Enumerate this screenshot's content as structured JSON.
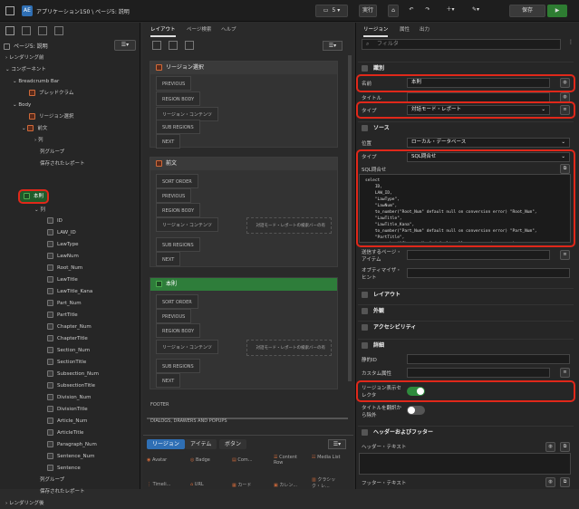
{
  "app": {
    "title": "アプリケーション150 \\ ページ5: 説明",
    "logo": "AE"
  },
  "toolbar": {
    "page_num": "5",
    "run": "実行",
    "save": "保存"
  },
  "left": {
    "title": "ページ5: 説明",
    "items": [
      "レンダリング前",
      "コンポーネント",
      "Breadcrumb Bar",
      "ブレッドクラム",
      "Body",
      "リージョン選択",
      "前文",
      "列",
      "列グループ",
      "保存されたレポート",
      "本則",
      "列",
      "ID",
      "LAW_ID",
      "LawType",
      "LawNum",
      "Root_Num",
      "LawTitle",
      "LawTitle_Kana",
      "Part_Num",
      "PartTitle",
      "Chapter_Num",
      "ChapterTitle",
      "Section_Num",
      "SectionTitle",
      "Subsection_Num",
      "SubsectionTitle",
      "Division_Num",
      "DivisionTitle",
      "Article_Num",
      "ArticleTitle",
      "Paragraph_Num",
      "Sentence_Num",
      "Sentence",
      "列グループ",
      "保存されたレポート",
      "レンダリング後"
    ]
  },
  "mid": {
    "tabs": [
      "レイアウト",
      "ページ検索",
      "ヘルプ"
    ],
    "r1": "リージョン選択",
    "r2": "前文",
    "r3": "本則",
    "slots1": [
      "PREVIOUS",
      "REGION BODY",
      "リージョン・コンテンツ",
      "SUB REGIONS",
      "NEXT"
    ],
    "slots2": [
      "SORT ORDER",
      "PREVIOUS",
      "REGION BODY",
      "リージョン・コンテンツ",
      "SUB REGIONS",
      "NEXT"
    ],
    "slots3": [
      "SORT ORDER",
      "PREVIOUS",
      "REGION BODY",
      "リージョン・コンテンツ",
      "SUB REGIONS",
      "NEXT"
    ],
    "card": "対話モード・レポートの検索バーの有",
    "footer": "FOOTER",
    "dialogs": "DIALOGS, DRAWERS AND POPUPS",
    "btabs": [
      "リージョン",
      "アイテム",
      "ボタン"
    ],
    "gallery": [
      "Avatar",
      "Badge",
      "Com...",
      "Content Row",
      "Media List",
      "Timeli...",
      "URL",
      "カード",
      "カレン...",
      "クラシック・レ..."
    ]
  },
  "right": {
    "tabs": [
      "リージョン",
      "属性",
      "出力"
    ],
    "filter": "フィルタ",
    "sec_id": "識別",
    "name_lbl": "名前",
    "name_val": "本則",
    "title_lbl": "タイトル",
    "type_lbl": "タイプ",
    "type_val": "対話モード・レポート",
    "sec_src": "ソース",
    "loc_lbl": "位置",
    "loc_val": "ローカル・データベース",
    "stype_lbl": "タイプ",
    "stype_val": "SQL問合せ",
    "sql_lbl": "SQL問合せ",
    "sql": "select\n    ID,\n    LAW_ID,\n    \"LawType\",\n    \"LawNum\",\n    to_number(\"Root_Num\" default null on conversion error) \"Root_Num\",\n    \"LawTitle\",\n    \"LawTitle_Kana\",\n    to_number(\"Part_Num\" default null on conversion error) \"Part_Num\",\n    \"PartTitle\",\n    to_number(\"Chapter_Num\" default null on conversion error)",
    "submit_lbl": "送信するページ・アイテム",
    "opt_lbl": "オプティマイザ・ヒント",
    "sec_layout": "レイアウト",
    "sec_look": "外観",
    "sec_acc": "アクセシビリティ",
    "sec_adv": "詳細",
    "static_lbl": "静的ID",
    "css_lbl": "カスタム属性",
    "sel_lbl": "リージョン表示セレクタ",
    "excl_lbl": "タイトルを翻訳から除外",
    "sec_hf": "ヘッダーおよびフッター",
    "head_lbl": "ヘッダー・テキスト",
    "foot_lbl": "フッター・テキスト"
  }
}
